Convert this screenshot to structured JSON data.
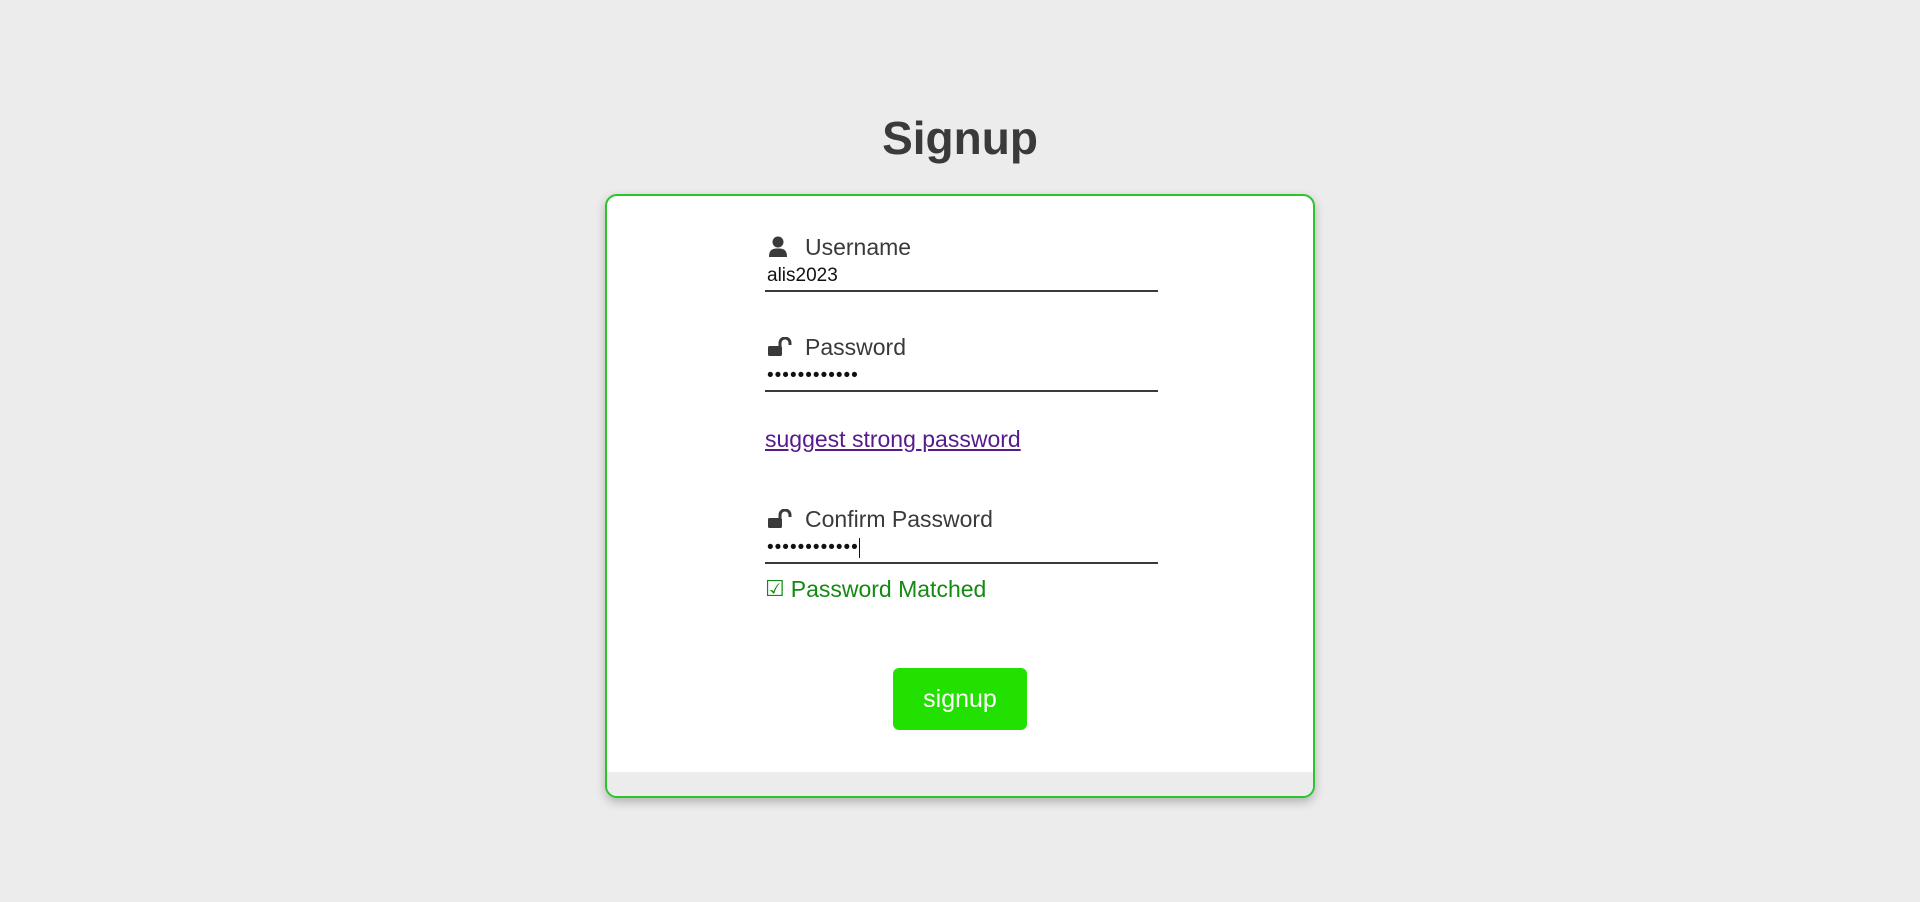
{
  "page": {
    "title": "Signup"
  },
  "form": {
    "username": {
      "label": "Username",
      "value": "alis2023",
      "icon": "user-icon"
    },
    "password": {
      "label": "Password",
      "value": "••••••••••••",
      "icon": "unlock-icon"
    },
    "suggest_link": "suggest strong password",
    "confirm_password": {
      "label": "Confirm Password",
      "value": "••••••••••••",
      "icon": "unlock-icon"
    },
    "match_status": {
      "check_glyph": "☑",
      "text": "Password Matched",
      "color": "#138a13"
    },
    "submit_label": "signup"
  },
  "colors": {
    "accent": "#22e000",
    "card_border": "#2bc42b",
    "link": "#551a8b",
    "background": "#edeced"
  }
}
